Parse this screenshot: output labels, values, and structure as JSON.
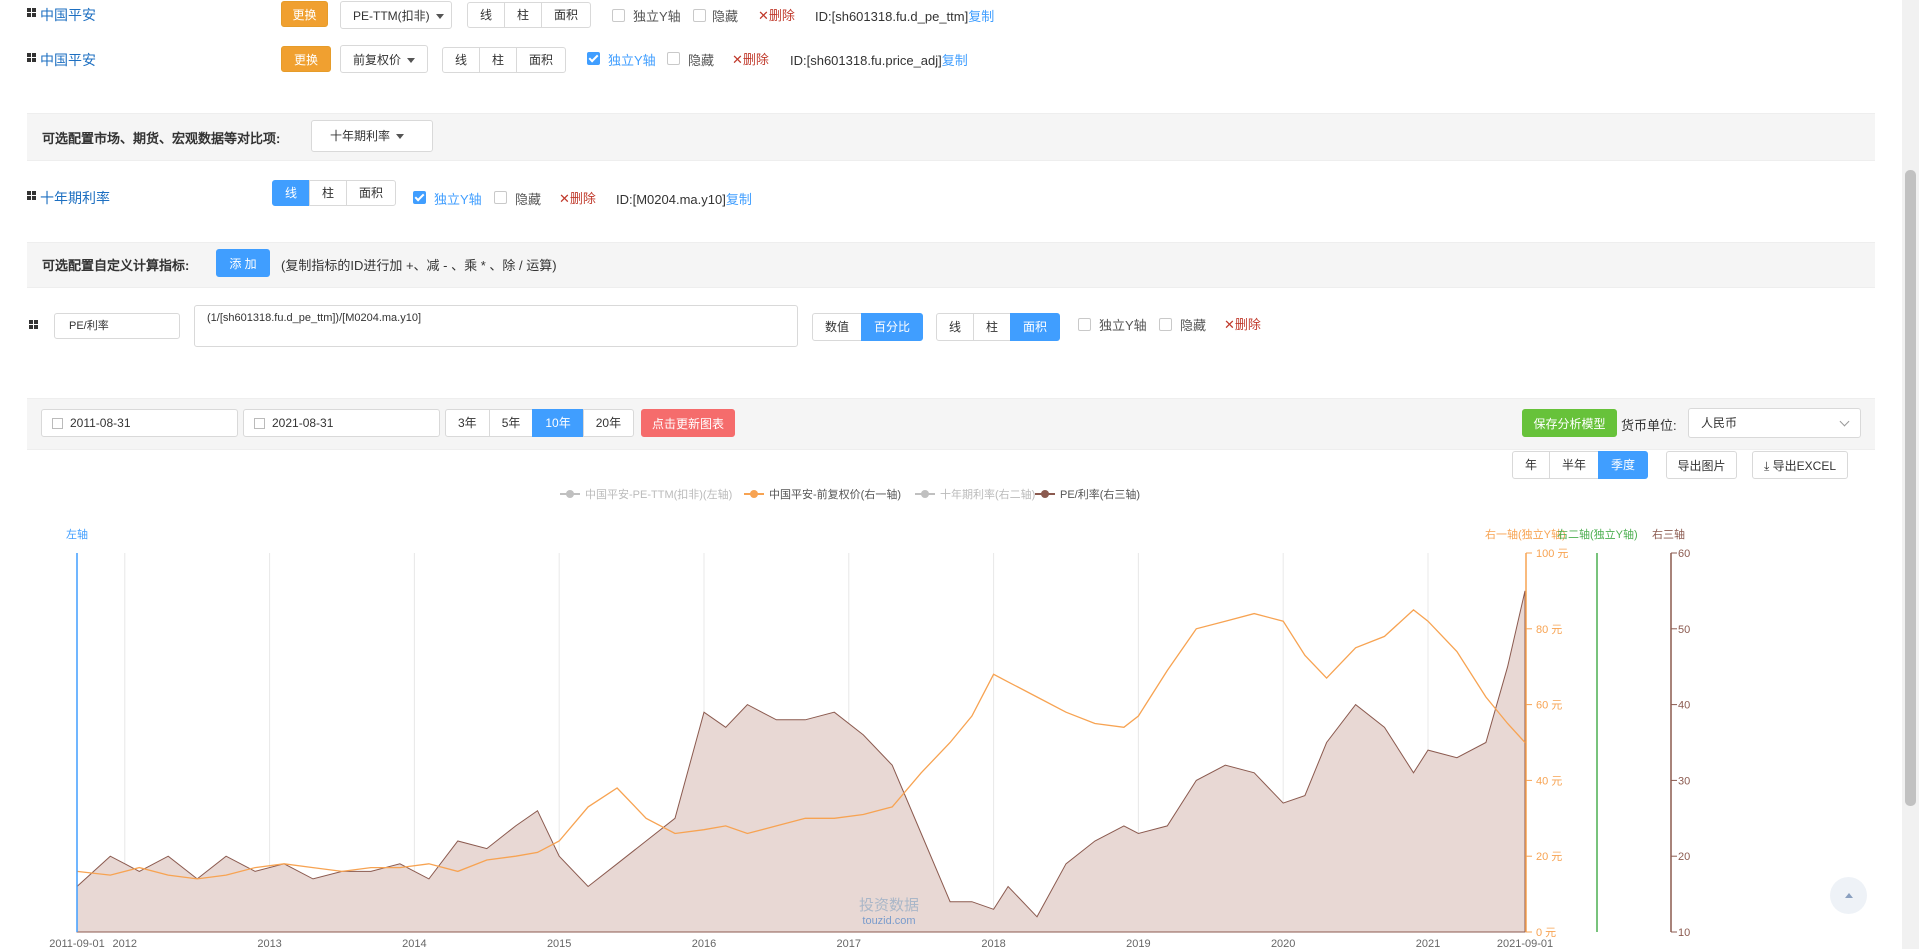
{
  "rows": [
    {
      "name": "中国平安",
      "change": "更换",
      "metric": "PE-TTM(扣非)",
      "chart_types": [
        "线",
        "柱",
        "面积"
      ],
      "active": -1,
      "indep_y": "独立Y轴",
      "indep_on": false,
      "hide": "隐藏",
      "del": "删除",
      "id": "ID:[sh601318.fu.d_pe_ttm]",
      "copy": "复制"
    },
    {
      "name": "中国平安",
      "change": "更换",
      "metric": "前复权价",
      "chart_types": [
        "线",
        "柱",
        "面积"
      ],
      "active": -1,
      "indep_y": "独立Y轴",
      "indep_on": true,
      "hide": "隐藏",
      "del": "删除",
      "id": "ID:[sh601318.fu.price_adj]",
      "copy": "复制"
    }
  ],
  "compare": {
    "label": "可选配置市场、期货、宏观数据等对比项:",
    "select": "十年期利率"
  },
  "rate_row": {
    "name": "十年期利率",
    "chart_types": [
      "线",
      "柱",
      "面积"
    ],
    "indep_y": "独立Y轴",
    "hide": "隐藏",
    "del": "删除",
    "id": "ID:[M0204.ma.y10]",
    "copy": "复制"
  },
  "custom": {
    "label": "可选配置自定义计算指标:",
    "add": "添 加",
    "hint": "(复制指标的ID进行加 +、减 - 、乘 * 、除 / 运算)"
  },
  "formula": {
    "name": "PE/利率",
    "expr": "(1/[sh601318.fu.d_pe_ttm])/[M0204.ma.y10]",
    "value_modes": [
      "数值",
      "百分比"
    ],
    "chart_types": [
      "线",
      "柱",
      "面积"
    ],
    "indep_y": "独立Y轴",
    "hide": "隐藏",
    "del": "删除"
  },
  "toolbar": {
    "start": "2011-08-31",
    "end": "2021-08-31",
    "ranges": [
      "3年",
      "5年",
      "10年",
      "20年"
    ],
    "refresh": "点击更新图表",
    "save": "保存分析模型",
    "currency_label": "货币单位:",
    "currency": "人民币",
    "periods": [
      "年",
      "半年",
      "季度"
    ],
    "export_img": "导出图片",
    "export_excel": "导出EXCEL"
  },
  "colors": {
    "accent": "#409eff",
    "orange": "#f0a030",
    "price_line": "#f7a352",
    "pe_area": "#8b5a4f",
    "rate": "#4caf50",
    "axis_left": "#409eff"
  },
  "chart_data": {
    "type": "area",
    "legend": [
      "中国平安-PE-TTM(扣非)(左轴)",
      "中国平安-前复权价(右一轴)",
      "十年期利率(右二轴)",
      "PE/利率(右三轴)"
    ],
    "axis_labels": {
      "left": "左轴",
      "right1": "右一轴(独立Y轴)",
      "right2": "右二轴(独立Y轴)",
      "right3": "右三轴"
    },
    "x_ticks": [
      "2011-09-01",
      "2012",
      "2013",
      "2014",
      "2015",
      "2016",
      "2017",
      "2018",
      "2019",
      "2020",
      "2021",
      "2021-09-01"
    ],
    "right1_ticks": [
      "0 元",
      "20 元",
      "40 元",
      "60 元",
      "80 元",
      "100 元"
    ],
    "right3_ticks": [
      "10",
      "20",
      "30",
      "40",
      "50",
      "60"
    ],
    "watermark": [
      "投资数据",
      "touzid.com"
    ],
    "x": [
      2011.67,
      2011.9,
      2012.1,
      2012.3,
      2012.5,
      2012.7,
      2012.9,
      2013.1,
      2013.3,
      2013.5,
      2013.7,
      2013.9,
      2014.1,
      2014.3,
      2014.5,
      2014.7,
      2014.85,
      2015.0,
      2015.2,
      2015.4,
      2015.6,
      2015.8,
      2016.0,
      2016.15,
      2016.3,
      2016.5,
      2016.7,
      2016.9,
      2017.1,
      2017.3,
      2017.5,
      2017.7,
      2017.85,
      2018.0,
      2018.1,
      2018.3,
      2018.5,
      2018.7,
      2018.9,
      2019.0,
      2019.2,
      2019.4,
      2019.6,
      2019.8,
      2020.0,
      2020.15,
      2020.3,
      2020.5,
      2020.7,
      2020.9,
      2021.0,
      2021.2,
      2021.4,
      2021.55,
      2021.67
    ],
    "series": [
      {
        "name": "中国平安-前复权价(右一轴)",
        "axis": "right1",
        "y": [
          16,
          15,
          17,
          15,
          14,
          15,
          17,
          18,
          17,
          16,
          17,
          17,
          18,
          16,
          19,
          20,
          21,
          24,
          33,
          38,
          30,
          26,
          27,
          28,
          26,
          28,
          30,
          30,
          31,
          33,
          42,
          50,
          57,
          68,
          66,
          62,
          58,
          55,
          54,
          57,
          69,
          80,
          82,
          84,
          82,
          73,
          67,
          75,
          78,
          85,
          82,
          74,
          62,
          55,
          50
        ]
      },
      {
        "name": "PE/利率(右三轴)",
        "axis": "right3",
        "y": [
          16,
          20,
          18,
          20,
          17,
          20,
          18,
          19,
          17,
          18,
          18,
          19,
          17,
          22,
          21,
          24,
          26,
          20,
          16,
          19,
          22,
          25,
          39,
          37,
          40,
          38,
          38,
          39,
          36,
          32,
          23,
          14,
          14,
          13,
          16,
          12,
          19,
          22,
          24,
          23,
          24,
          30,
          32,
          31,
          27,
          28,
          35,
          40,
          37,
          31,
          34,
          33,
          35,
          45,
          55
        ]
      }
    ],
    "right1_range": [
      0,
      100
    ],
    "right3_range": [
      10,
      60
    ]
  }
}
